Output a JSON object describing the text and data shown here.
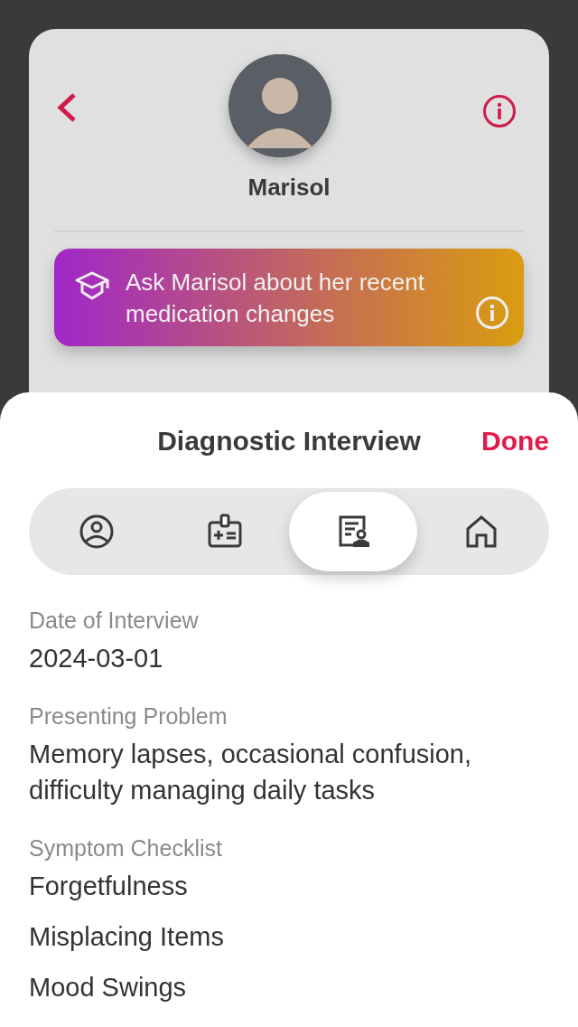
{
  "profile": {
    "name": "Marisol"
  },
  "banner": {
    "text": "Ask Marisol about her recent medication changes"
  },
  "sheet": {
    "title": "Diagnostic Interview",
    "done": "Done"
  },
  "tabs": [
    {
      "kind": "person",
      "selected": false
    },
    {
      "kind": "badge",
      "selected": false
    },
    {
      "kind": "report",
      "selected": true
    },
    {
      "kind": "home",
      "selected": false
    }
  ],
  "fields": [
    {
      "label": "Date of Interview",
      "values": [
        "2024-03-01"
      ]
    },
    {
      "label": "Presenting Problem",
      "values": [
        "Memory lapses, occasional confusion, difficulty managing daily tasks"
      ]
    },
    {
      "label": "Symptom Checklist",
      "values": [
        "Forgetfulness",
        "Misplacing Items",
        "Mood Swings"
      ]
    }
  ]
}
